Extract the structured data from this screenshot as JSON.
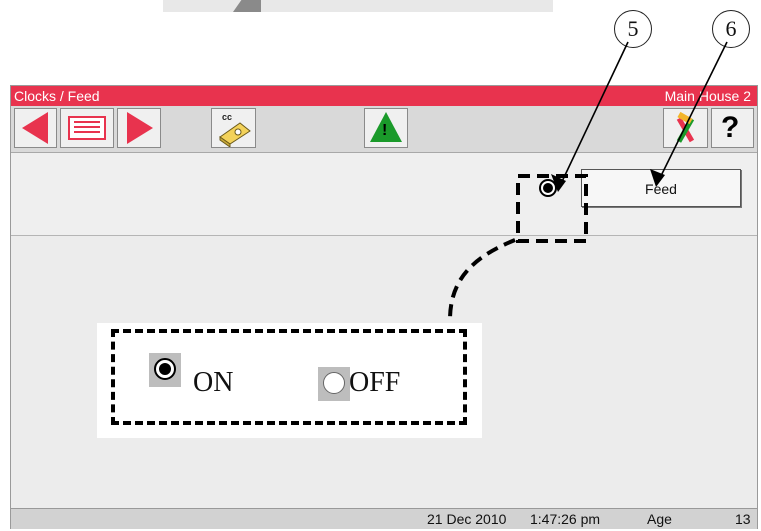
{
  "window": {
    "title": "Clocks / Feed",
    "house": "Main House 2"
  },
  "toolbar": {
    "back_icon": "left-arrow-icon",
    "menu_icon": "menu-list-icon",
    "forward_icon": "right-arrow-icon",
    "cc_label": "cc",
    "cc_icon": "feed-clock-icon",
    "alarm_icon": "warning-icon",
    "alarm_mark": "!",
    "tools_icon": "tools-icon",
    "help_label": "?"
  },
  "panel": {
    "feed_button_label": "Feed",
    "feed_radio_state": "on"
  },
  "status": {
    "date": "21 Dec 2010",
    "time": "1:47:26 pm",
    "age_label": "Age",
    "age_value": "13"
  },
  "callouts": [
    "5",
    "6"
  ],
  "legend": {
    "on_label": "ON",
    "off_label": "OFF"
  },
  "colors": {
    "titlebar": "#e8334e",
    "alarm": "#1a9a2a"
  }
}
